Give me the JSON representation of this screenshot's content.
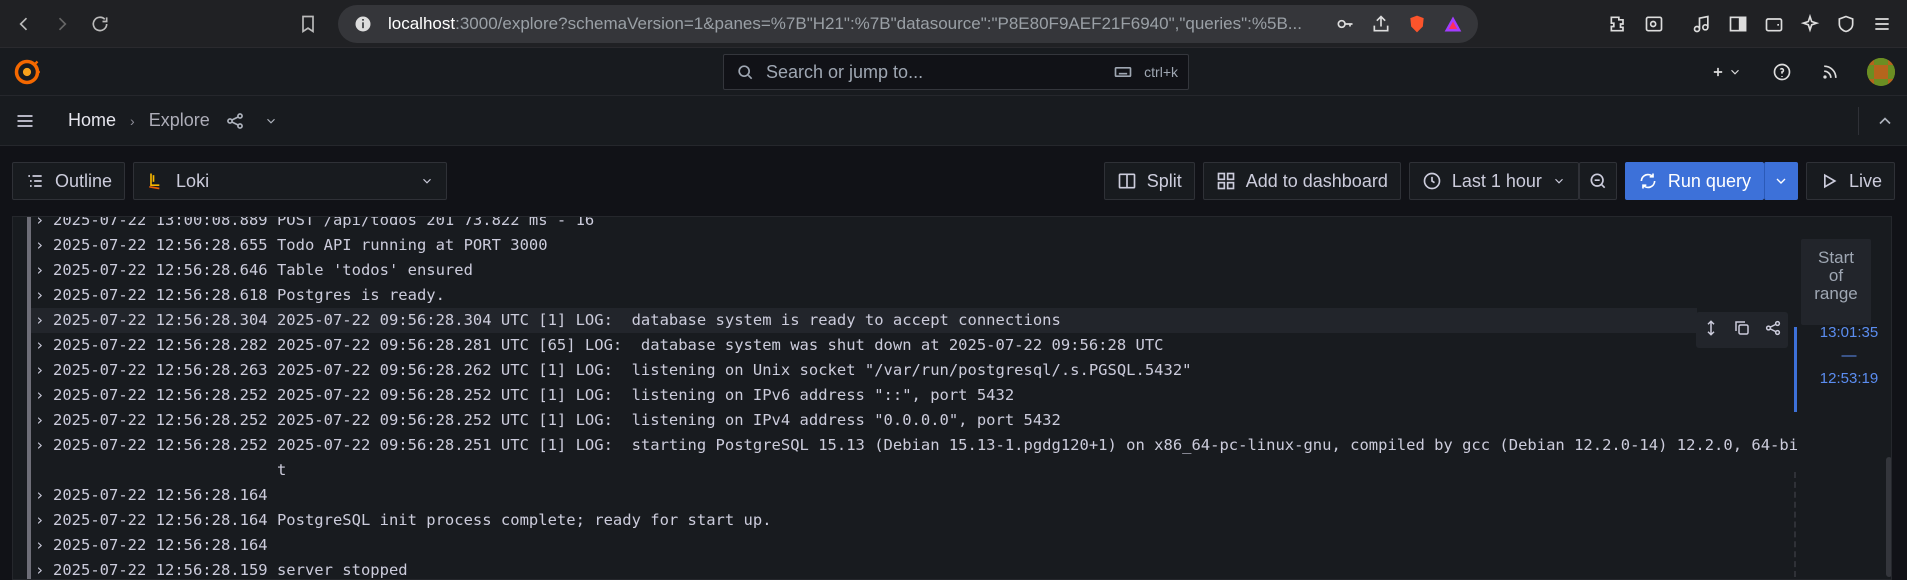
{
  "browser": {
    "url_host": "localhost",
    "url_rest": ":3000/explore?schemaVersion=1&panes=%7B\"H21\":%7B\"datasource\":\"P8E80F9AEF21F6940\",\"queries\":%5B..."
  },
  "grafana": {
    "search_placeholder": "Search or jump to...",
    "search_shortcut": "ctrl+k"
  },
  "breadcrumb": {
    "home": "Home",
    "current": "Explore"
  },
  "toolbar": {
    "outline_label": "Outline",
    "datasource": "Loki",
    "split_label": "Split",
    "add_dashboard_label": "Add to dashboard",
    "time_range": "Last 1 hour",
    "run_query_label": "Run query",
    "live_label": "Live"
  },
  "logs": [
    {
      "text": "2025-07-22 13:00:08.889 POST /api/todos 201 73.822 ms - 16"
    },
    {
      "text": "2025-07-22 12:56:28.655 Todo API running at PORT 3000"
    },
    {
      "text": "2025-07-22 12:56:28.646 Table 'todos' ensured"
    },
    {
      "text": "2025-07-22 12:56:28.618 Postgres is ready."
    },
    {
      "text": "2025-07-22 12:56:28.304 2025-07-22 09:56:28.304 UTC [1] LOG:  database system is ready to accept connections"
    },
    {
      "text": "2025-07-22 12:56:28.282 2025-07-22 09:56:28.281 UTC [65] LOG:  database system was shut down at 2025-07-22 09:56:28 UTC"
    },
    {
      "text": "2025-07-22 12:56:28.263 2025-07-22 09:56:28.262 UTC [1] LOG:  listening on Unix socket \"/var/run/postgresql/.s.PGSQL.5432\""
    },
    {
      "text": "2025-07-22 12:56:28.252 2025-07-22 09:56:28.252 UTC [1] LOG:  listening on IPv6 address \"::\", port 5432"
    },
    {
      "text": "2025-07-22 12:56:28.252 2025-07-22 09:56:28.252 UTC [1] LOG:  listening on IPv4 address \"0.0.0.0\", port 5432"
    },
    {
      "text": "2025-07-22 12:56:28.252 2025-07-22 09:56:28.251 UTC [1] LOG:  starting PostgreSQL 15.13 (Debian 15.13-1.pgdg120+1) on x86_64-pc-linux-gnu, compiled by gcc (Debian 12.2.0-14) 12.2.0, 64-bi"
    },
    {
      "text": "                        t"
    },
    {
      "text": "2025-07-22 12:56:28.164"
    },
    {
      "text": "2025-07-22 12:56:28.164 PostgreSQL init process complete; ready for start up."
    },
    {
      "text": "2025-07-22 12:56:28.164"
    },
    {
      "text": "2025-07-22 12:56:28.159 server stopped"
    }
  ],
  "range": {
    "start_label_1": "Start",
    "start_label_2": "of",
    "start_label_3": "range",
    "time_from": "13:01:35",
    "dash": "—",
    "time_to": "12:53:19"
  }
}
